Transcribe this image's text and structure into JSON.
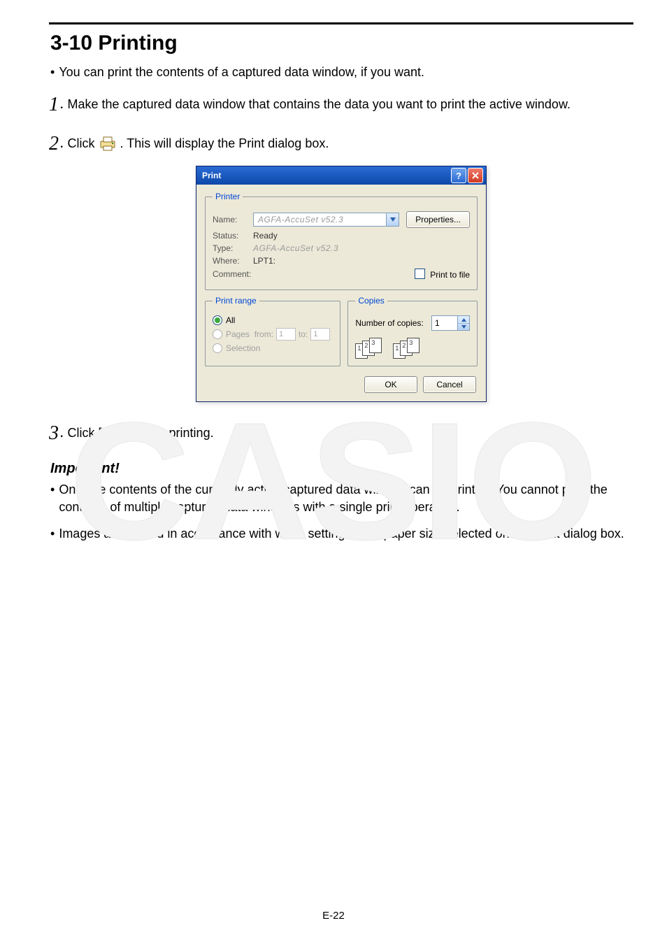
{
  "section_title": "3-10 Printing",
  "intro_bullet": "You can print the contents of a captured data window, if you want.",
  "step1": {
    "num": "1",
    "text": "Make the captured data window that contains the data you want to print the active window."
  },
  "step2": {
    "num": "2",
    "pre": "Click ",
    "post": ". This will display the Print dialog box."
  },
  "step3": {
    "num": "3",
    "text": "Click [OK] to start printing."
  },
  "important_heading": "Important!",
  "important_bullets": [
    "Only the contents of the currently active captured data window can be printed. You cannot print the contents of multiple captured data windows with a single print operation.",
    "Images are printed in accordance with width setting of the paper size selected on the Print dialog box."
  ],
  "footer": "E-22",
  "dialog": {
    "title": "Print",
    "printer": {
      "legend": "Printer",
      "name_label": "Name:",
      "name_value": "AGFA-AccuSet v52.3",
      "properties_btn": "Properties...",
      "status_label": "Status:",
      "status_value": "Ready",
      "type_label": "Type:",
      "type_value": "AGFA-AccuSet v52.3",
      "where_label": "Where:",
      "where_value": "LPT1:",
      "comment_label": "Comment:",
      "print_to_file": "Print to file"
    },
    "range": {
      "legend": "Print range",
      "all": "All",
      "pages": "Pages",
      "from": "from:",
      "to": "to:",
      "from_val": "1",
      "to_val": "1",
      "selection": "Selection"
    },
    "copies": {
      "legend": "Copies",
      "num_label": "Number of copies:",
      "num_value": "1",
      "seq1": [
        "1",
        "2",
        "3"
      ],
      "seq2": [
        "1",
        "2",
        "3"
      ]
    },
    "ok": "OK",
    "cancel": "Cancel"
  }
}
